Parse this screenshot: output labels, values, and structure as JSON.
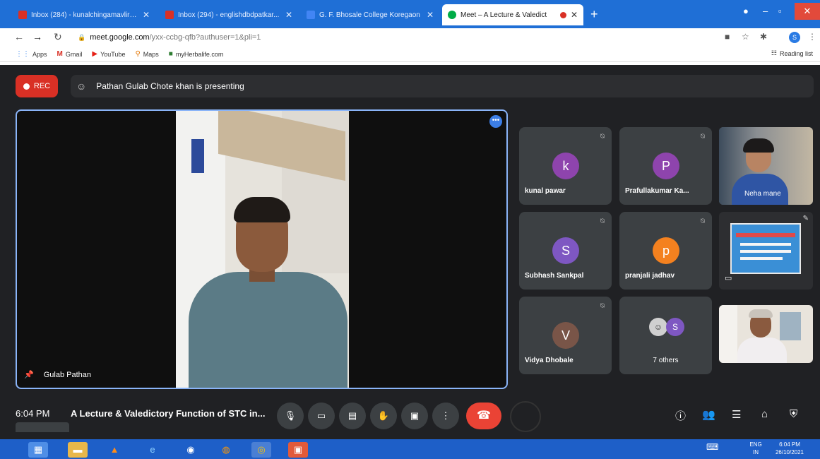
{
  "browser": {
    "tabs": [
      {
        "title": "Inbox (284) - kunalchingamavlir@...",
        "favicon_color": "#d93025"
      },
      {
        "title": "Inbox (294) - englishdbdpatkar...",
        "favicon_color": "#d93025"
      },
      {
        "title": "G. F. Bhosale College Koregaon",
        "favicon_color": "#4285f4"
      },
      {
        "title": "Meet – A Lecture & Valedict",
        "favicon_color": "#00ac47",
        "active": true
      }
    ],
    "tab_close": "✕",
    "new_tab": "+",
    "url_host": "meet.google.com",
    "url_path": "/yxx-ccbg-qfb?authuser=1&pli=1",
    "profile_initial": "S",
    "bookmarks": [
      {
        "label": "Apps",
        "icon": "apps-grid-icon"
      },
      {
        "label": "Gmail",
        "icon": "gmail-icon"
      },
      {
        "label": "YouTube",
        "icon": "youtube-icon"
      },
      {
        "label": "Maps",
        "icon": "maps-pin-icon"
      },
      {
        "label": "myHerbalife.com",
        "icon": "herbalife-icon"
      }
    ],
    "reading_list": "Reading list"
  },
  "meet": {
    "rec_label": "REC",
    "presenting_text": "Pathan Gulab Chote khan is presenting",
    "main_name": "Gulab Pathan",
    "more_button": "•••",
    "tiles": [
      {
        "name": "kunal pawar",
        "initial": "k",
        "color": "#8e44ad"
      },
      {
        "name": "Prafullakumar Ka...",
        "initial": "P",
        "color": "#8e44ad"
      },
      {
        "name": "Neha mane"
      },
      {
        "name": "Subhash Sankpal",
        "initial": "S",
        "color": "#7e57c2"
      },
      {
        "name": "pranjali jadhav",
        "initial": "p",
        "color": "#f4811f"
      },
      {
        "name": "Vidya Dhobale",
        "initial": "V",
        "color": "#795548"
      },
      {
        "name": "7 others",
        "initial": "S"
      }
    ],
    "time": "6:04 PM",
    "meeting_title": "A Lecture & Valedictory Function of STC in...",
    "end_call_color": "#ea4335"
  },
  "taskbar": {
    "lang_top": "ENG",
    "lang_bottom": "IN",
    "clock_time": "6:04 PM",
    "clock_date": "26/10/2021"
  }
}
